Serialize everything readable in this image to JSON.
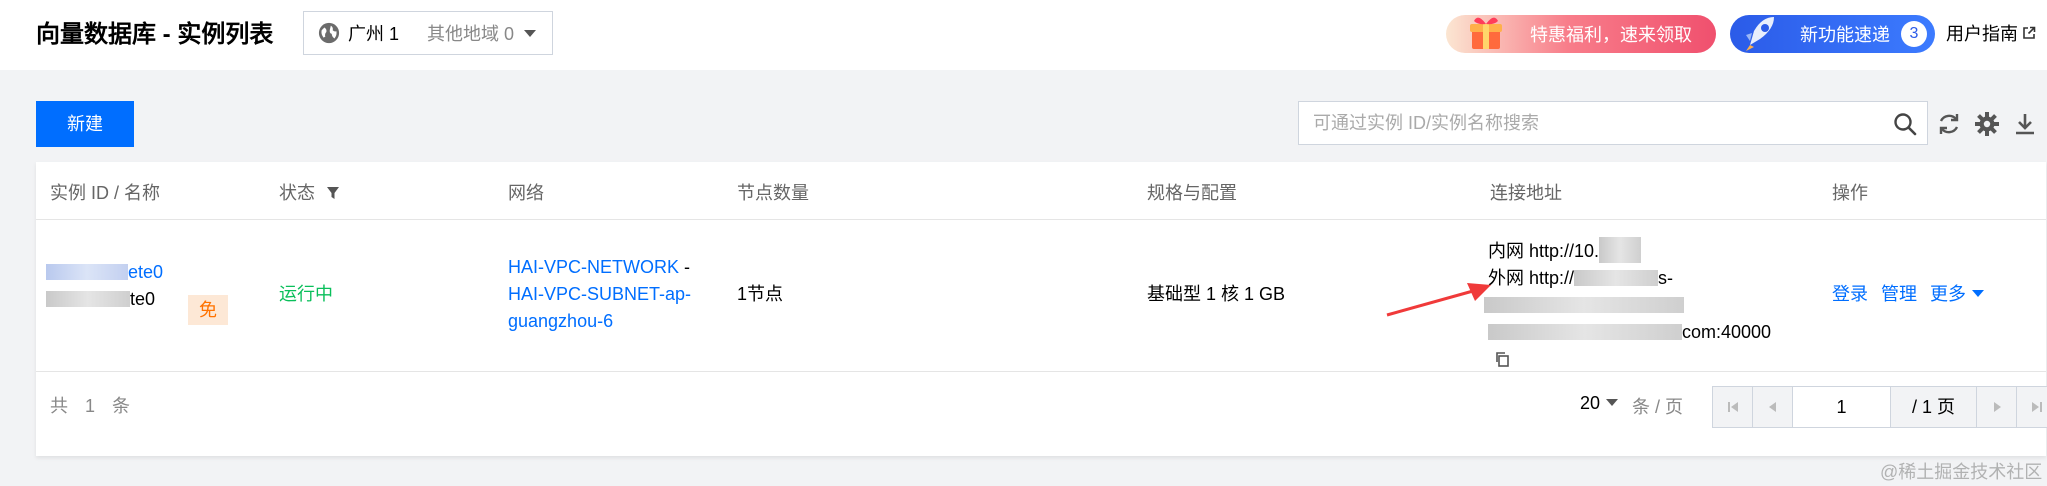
{
  "header": {
    "title": "向量数据库 - 实例列表",
    "region_current": "广州 1",
    "region_other": "其他地域 0",
    "promo_label": "特惠福利，速来领取",
    "newfeature_label": "新功能速递",
    "newfeature_count": "3",
    "guide_label": "用户指南"
  },
  "toolbar": {
    "new_label": "新建",
    "search_placeholder": "可通过实例 ID/实例名称搜索"
  },
  "table": {
    "columns": {
      "id_name": "实例 ID / 名称",
      "status": "状态",
      "network": "网络",
      "nodes": "节点数量",
      "spec": "规格与配置",
      "address": "连接地址",
      "actions": "操作"
    },
    "rows": [
      {
        "id_suffix": "ete0",
        "name_suffix": "te0",
        "free_tag": "免",
        "status": "运行中",
        "network_vpc": "HAI-VPC-NETWORK",
        "network_sep": " -",
        "network_subnet_1": "HAI-VPC-SUBNET-ap-",
        "network_subnet_2": "guangzhou-6",
        "nodes": "1节点",
        "spec": "基础型 1 核 1 GB",
        "addr_inner_prefix": "内网 http://10.",
        "addr_outer_prefix": "外网 http://",
        "addr_outer_mid": "s-",
        "addr_port_suffix": "com:40000",
        "action_login": "登录",
        "action_manage": "管理",
        "action_more": "更多"
      }
    ]
  },
  "footer": {
    "total": "共 1 条",
    "page_size": "20",
    "per_page_label": "条 / 页",
    "page_input": "1",
    "page_total": "/ 1 页"
  },
  "watermark": "@稀土掘金技术社区",
  "colors": {
    "primary": "#006eff",
    "running": "#0abf5b",
    "free_tag_bg": "#fde8d6",
    "free_tag_text": "#ff7200",
    "annotation_arrow": "#f03a3a"
  }
}
